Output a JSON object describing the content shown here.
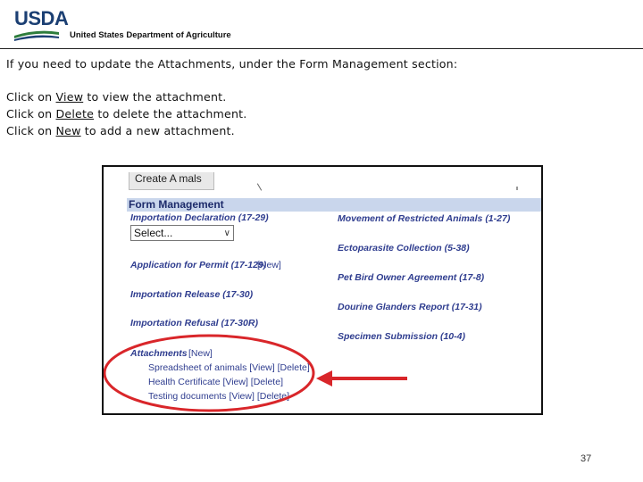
{
  "header": {
    "logo_text": "USDA",
    "department": "United States Department of Agriculture"
  },
  "instructions": {
    "intro": "If you need to update the Attachments, under the Form Management section:",
    "view": {
      "prefix": "Click on ",
      "link": "View",
      "suffix": " to view the attachment."
    },
    "delete": {
      "prefix": "Click on ",
      "link": "Delete",
      "suffix": " to delete the attachment."
    },
    "new": {
      "prefix": "Click on ",
      "link": "New",
      "suffix": " to add a new attachment."
    }
  },
  "screenshot": {
    "tab_label": "Create A  mals",
    "section_title": "Form Management",
    "left_forms": {
      "importation_declaration": "Importation Declaration (17-29)",
      "select_value": "Select...",
      "application_for_permit": "Application for Permit (17-129)",
      "application_new": "[New]",
      "importation_release": "Importation Release (17-30)",
      "importation_refusal": "Importation Refusal (17-30R)"
    },
    "right_forms": [
      "Movement of Restricted Animals (1-27)",
      "Ectoparasite Collection (5-38)",
      "Pet Bird Owner Agreement (17-8)",
      "Dourine Glanders Report (17-31)",
      "Specimen Submission (10-4)"
    ],
    "attachments": {
      "label": "Attachments",
      "new_link": "[New]",
      "items": [
        {
          "name": "Spreadsheet of animals",
          "view": "[View]",
          "delete": "[Delete]"
        },
        {
          "name": "Health Certificate",
          "view": "[View]",
          "delete": "[Delete]"
        },
        {
          "name": "Testing documents",
          "view": "[View]",
          "delete": "[Delete]"
        }
      ]
    }
  },
  "annotation_color": "#d9262a",
  "page_number": "37"
}
